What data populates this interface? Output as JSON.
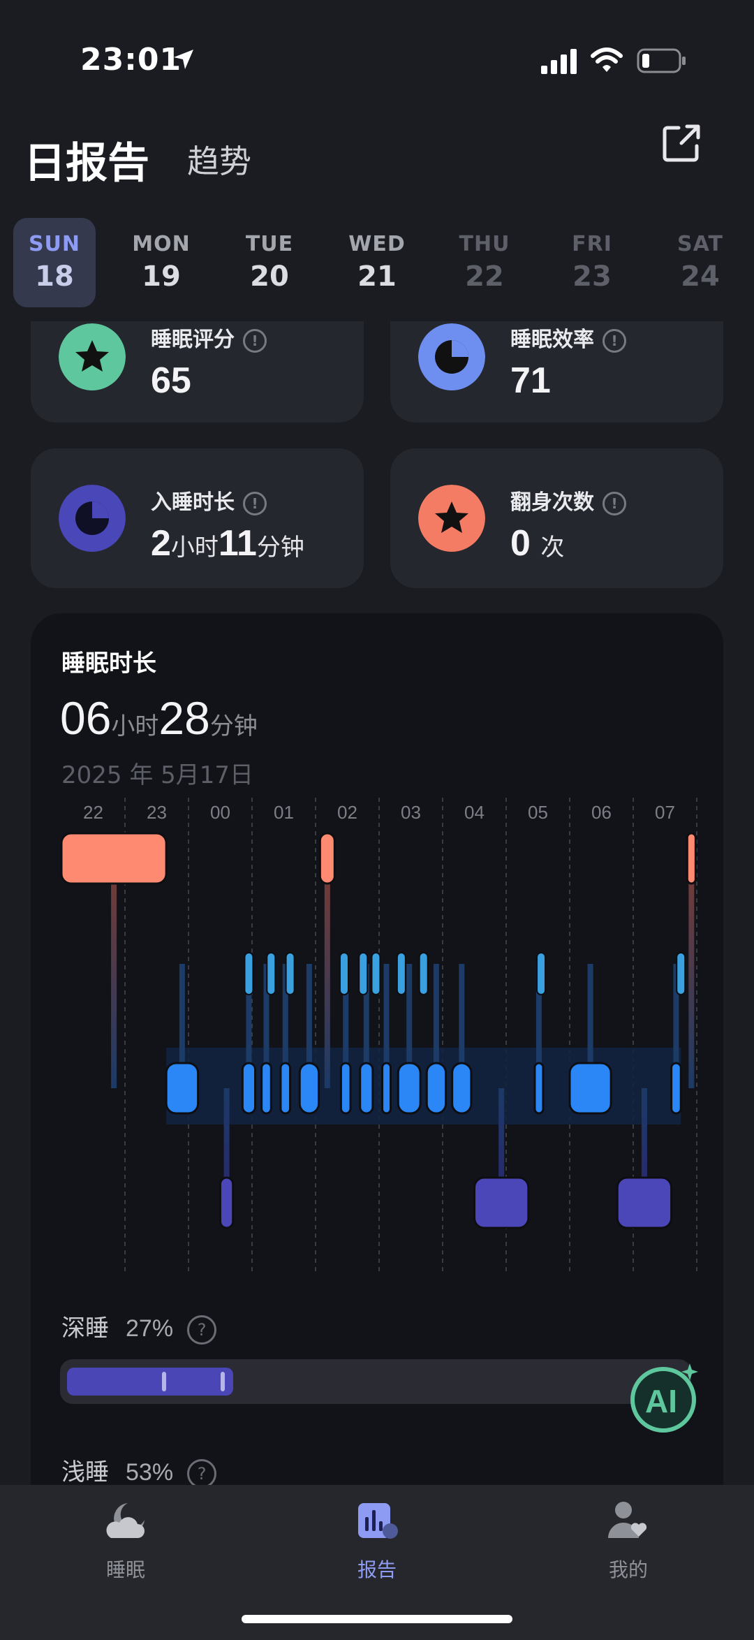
{
  "status_bar": {
    "time": "23:01"
  },
  "header": {
    "title": "日报告",
    "trend_tab": "趋势"
  },
  "week": [
    {
      "name": "SUN",
      "date": "18",
      "state": "selected"
    },
    {
      "name": "MON",
      "date": "19",
      "state": "past"
    },
    {
      "name": "TUE",
      "date": "20",
      "state": "past"
    },
    {
      "name": "WED",
      "date": "21",
      "state": "past"
    },
    {
      "name": "THU",
      "date": "22",
      "state": "future"
    },
    {
      "name": "FRI",
      "date": "23",
      "state": "future"
    },
    {
      "name": "SAT",
      "date": "24",
      "state": "future"
    }
  ],
  "metrics": {
    "score": {
      "label": "睡眠评分",
      "value": "65",
      "icon": "star-icon",
      "color": "#5fc79d"
    },
    "efficiency": {
      "label": "睡眠效率",
      "value": "71",
      "icon": "pie-icon",
      "color": "#6e8ff0"
    },
    "latency": {
      "label": "入睡时长",
      "hours": "2",
      "hours_unit": "小时",
      "minutes": "11",
      "minutes_unit": "分钟",
      "icon": "pie-icon",
      "color": "#4a47b8"
    },
    "turns": {
      "label": "翻身次数",
      "value": "0",
      "unit": "次",
      "icon": "star-icon",
      "color": "#f47c65"
    }
  },
  "sleep_panel": {
    "title": "睡眠时长",
    "hours": "06",
    "hours_unit": "小时",
    "minutes": "28",
    "minutes_unit": "分钟",
    "date": "2025 年 5月17日"
  },
  "chart_data": {
    "type": "bar",
    "x_ticks": [
      "22",
      "23",
      "00",
      "01",
      "02",
      "03",
      "04",
      "05",
      "06",
      "07"
    ],
    "stages": [
      "awake",
      "light",
      "deep"
    ],
    "colors": {
      "awake": "#ff8a72",
      "light": "#2b86f6",
      "deep": "#4c47b8"
    },
    "segments": [
      {
        "stage": "awake",
        "start": 22.0,
        "end": 23.65
      },
      {
        "stage": "light",
        "start": 23.65,
        "end": 24.15
      },
      {
        "stage": "deep",
        "start": 24.5,
        "end": 24.7
      },
      {
        "stage": "light",
        "start": 24.85,
        "end": 25.05
      },
      {
        "stage": "light",
        "start": 25.15,
        "end": 25.3
      },
      {
        "stage": "light",
        "start": 25.45,
        "end": 25.6
      },
      {
        "stage": "light",
        "start": 25.75,
        "end": 26.05
      },
      {
        "stage": "awake",
        "start": 26.07,
        "end": 26.3
      },
      {
        "stage": "light",
        "start": 26.4,
        "end": 26.55
      },
      {
        "stage": "light",
        "start": 26.7,
        "end": 26.9
      },
      {
        "stage": "light",
        "start": 27.05,
        "end": 27.15
      },
      {
        "stage": "light",
        "start": 27.3,
        "end": 27.65
      },
      {
        "stage": "light",
        "start": 27.75,
        "end": 28.05
      },
      {
        "stage": "light",
        "start": 28.15,
        "end": 28.45
      },
      {
        "stage": "deep",
        "start": 28.5,
        "end": 29.35
      },
      {
        "stage": "light",
        "start": 29.45,
        "end": 29.55
      },
      {
        "stage": "light",
        "start": 30.0,
        "end": 30.65
      },
      {
        "stage": "deep",
        "start": 30.75,
        "end": 31.6
      },
      {
        "stage": "light",
        "start": 31.6,
        "end": 31.75
      },
      {
        "stage": "awake",
        "start": 31.85,
        "end": 31.95
      }
    ]
  },
  "stages_legend": [
    {
      "name": "深睡",
      "pct": "27%"
    },
    {
      "name": "浅睡",
      "pct": "53%"
    }
  ],
  "deep_bar": {
    "fill": 0.27
  },
  "tabs": [
    {
      "label": "睡眠",
      "icon": "moon-cloud-icon",
      "active": false
    },
    {
      "label": "报告",
      "icon": "report-chart-icon",
      "active": true
    },
    {
      "label": "我的",
      "icon": "user-heart-icon",
      "active": false
    }
  ]
}
